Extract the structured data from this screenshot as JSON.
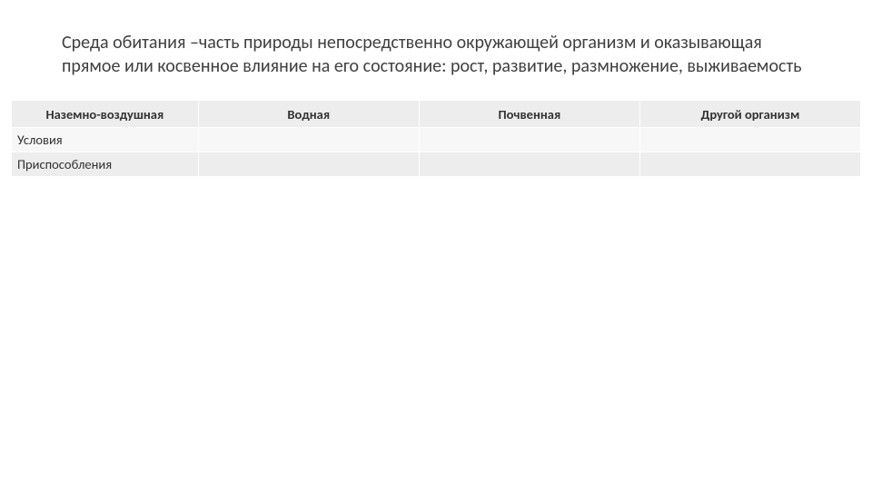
{
  "title": "Среда обитания –часть природы непосредственно окружающей организм и оказывающая прямое или косвенное влияние на его состояние: рост, развитие, размножение, выживаемость",
  "table": {
    "headers": [
      "Наземно-воздушная",
      "Водная",
      "Почвенная",
      "Другой организм"
    ],
    "rows": [
      {
        "label": "Условия",
        "cells": [
          "",
          "",
          ""
        ]
      },
      {
        "label": "Приспособления",
        "cells": [
          "",
          "",
          ""
        ]
      }
    ]
  }
}
